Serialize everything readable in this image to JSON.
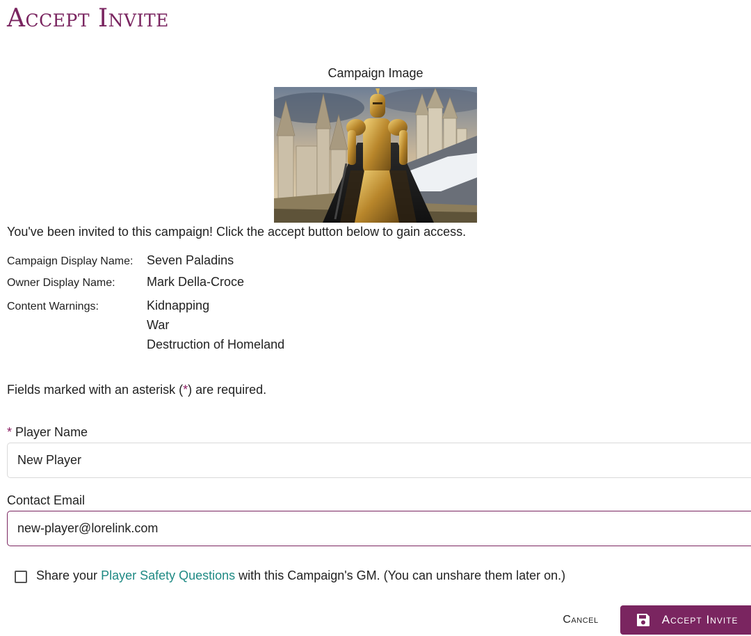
{
  "page": {
    "title": "Accept Invite"
  },
  "campaign_image": {
    "caption": "Campaign Image"
  },
  "invite_message": "You've been invited to this campaign! Click the accept button below to gain access.",
  "details": {
    "campaign_display_name_label": "Campaign Display Name:",
    "campaign_display_name": "Seven Paladins",
    "owner_display_name_label": "Owner Display Name:",
    "owner_display_name": "Mark Della-Croce",
    "content_warnings_label": "Content Warnings:",
    "content_warnings": [
      "Kidnapping",
      "War",
      "Destruction of Homeland"
    ]
  },
  "required_note": {
    "before": "Fields marked with an asterisk (",
    "asterisk": "*",
    "after": ") are required."
  },
  "form": {
    "player_name": {
      "required_marker": "*",
      "label": "Player Name",
      "value": "New Player"
    },
    "contact_email": {
      "label": "Contact Email",
      "value": "new-player@lorelink.com"
    },
    "share_safety": {
      "checked": false,
      "text_before": "Share your ",
      "link_text": "Player Safety Questions",
      "text_after": " with this Campaign's GM. (You can unshare them later on.)"
    }
  },
  "actions": {
    "cancel_label": "Cancel",
    "accept_label": "Accept Invite",
    "accept_icon": "save-icon"
  },
  "colors": {
    "brand": "#7a2560",
    "link": "#1f8a84",
    "asterisk": "#8b1c62"
  }
}
